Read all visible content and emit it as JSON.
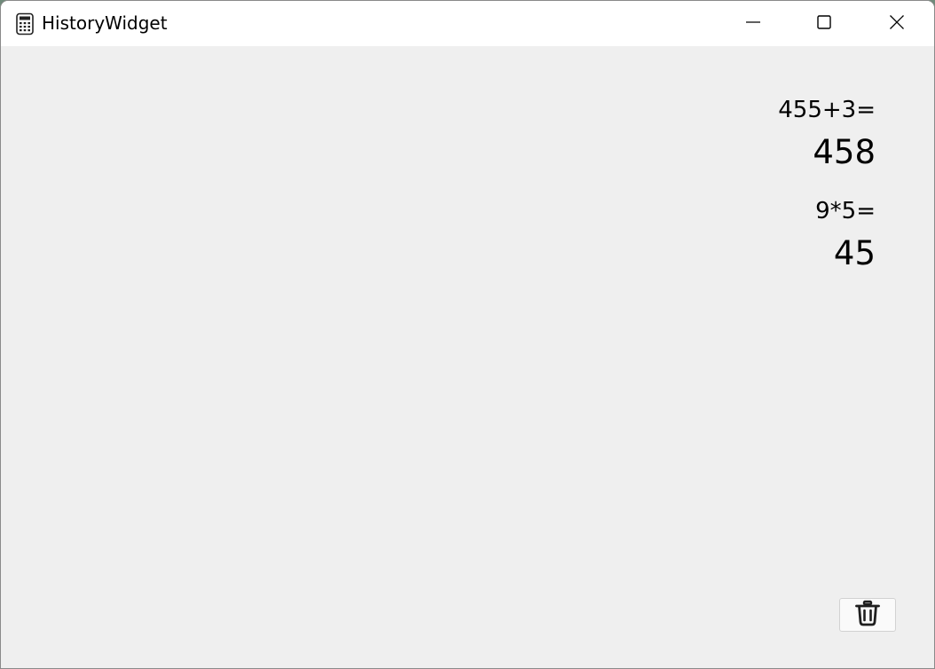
{
  "window": {
    "title": "HistoryWidget"
  },
  "history": [
    {
      "expression": "455+3=",
      "result": "458"
    },
    {
      "expression": "9*5=",
      "result": "45"
    }
  ],
  "icons": {
    "app": "calculator-icon",
    "minimize": "minimize-icon",
    "maximize": "maximize-icon",
    "close": "close-icon",
    "clear_history": "trash-icon"
  }
}
